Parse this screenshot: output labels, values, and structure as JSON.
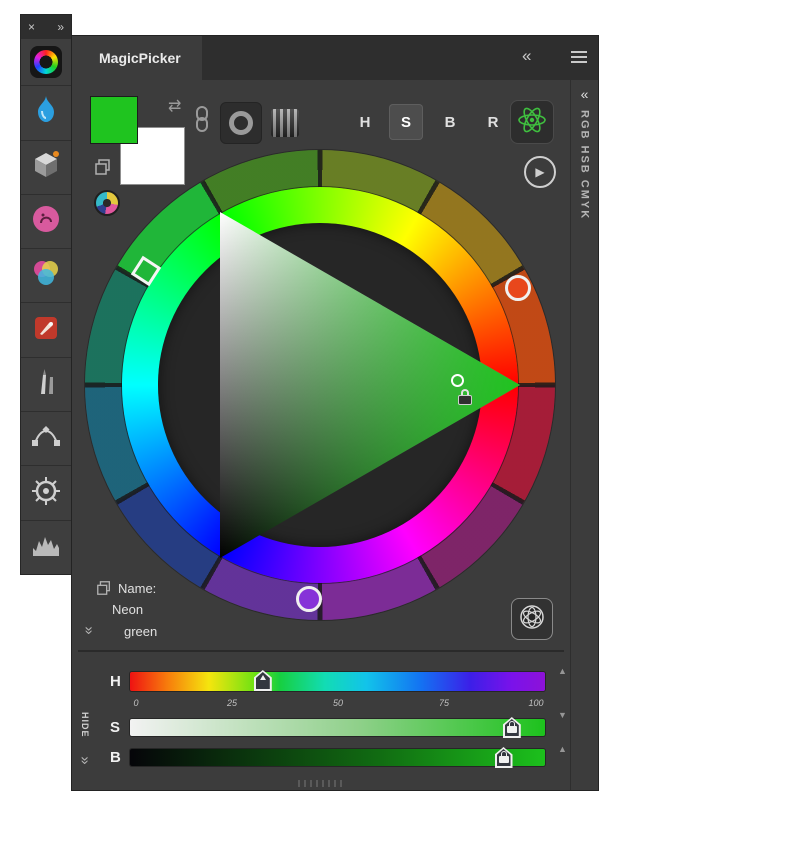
{
  "colors": {
    "foreground": "#1FC41F",
    "background": "#FFFFFF",
    "accent_green": "#3FBF3F"
  },
  "icons": {
    "swap": "⇄",
    "play": "▶",
    "up_arrow": "▲",
    "down_arrow": "▼",
    "double_chevron_left": "«",
    "double_chevron_right": "»",
    "close": "×"
  },
  "sidebar": {
    "tools": [
      "magicpicker-wheel",
      "magic-brush",
      "mixer-cube",
      "portrait",
      "color-mix-circles",
      "paint-book",
      "brushes",
      "bezier-pen",
      "ship-wheel",
      "histogram"
    ]
  },
  "header": {
    "title": "MagicPicker"
  },
  "side_tab": {
    "label": "RGB HSB CMYK"
  },
  "toolbar": {
    "modes": [
      {
        "label": "H",
        "active": false
      },
      {
        "label": "S",
        "active": true
      },
      {
        "label": "B",
        "active": false
      },
      {
        "label": "R",
        "active": false
      }
    ]
  },
  "color_name": {
    "label": "Name:",
    "line1": "Neon",
    "line2": "green"
  },
  "sliders": {
    "hide_label": "HIDE",
    "scale": [
      "0",
      "25",
      "50",
      "75",
      "100"
    ],
    "h": {
      "label": "H",
      "value_pct": 32
    },
    "s": {
      "label": "S",
      "value_pct": 92
    },
    "b": {
      "label": "B",
      "value_pct": 90
    }
  }
}
